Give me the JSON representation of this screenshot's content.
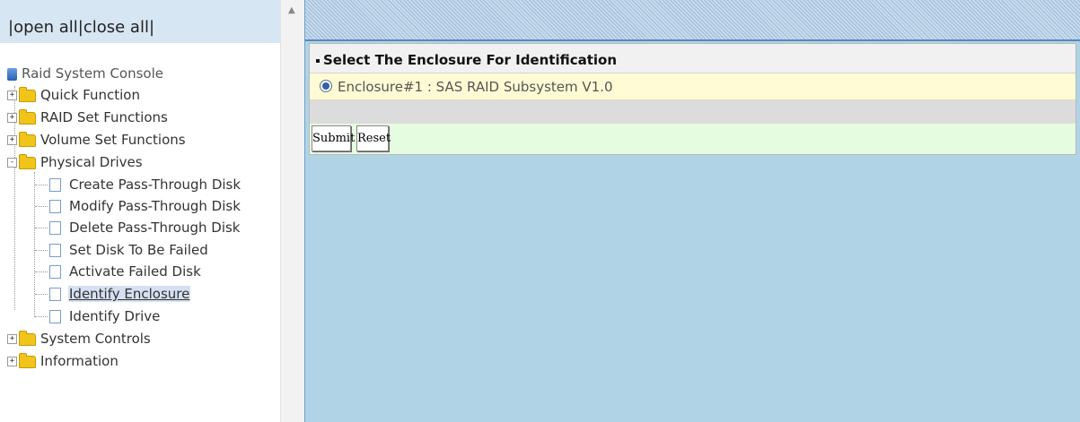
{
  "header": {
    "open_all": "open all",
    "close_all": "close all"
  },
  "tree": {
    "root": "Raid System Console",
    "items": [
      {
        "label": "Quick Function",
        "toggle": "+"
      },
      {
        "label": "RAID Set Functions",
        "toggle": "+"
      },
      {
        "label": "Volume Set Functions",
        "toggle": "+"
      },
      {
        "label": "Physical Drives",
        "toggle": "-",
        "children": [
          {
            "label": "Create Pass-Through Disk"
          },
          {
            "label": "Modify Pass-Through Disk"
          },
          {
            "label": "Delete Pass-Through Disk"
          },
          {
            "label": "Set Disk To Be Failed"
          },
          {
            "label": "Activate Failed Disk"
          },
          {
            "label": "Identify Enclosure",
            "selected": true
          },
          {
            "label": "Identify Drive"
          }
        ]
      },
      {
        "label": "System Controls",
        "toggle": "+"
      },
      {
        "label": "Information",
        "toggle": "+"
      }
    ]
  },
  "form": {
    "title": "Select The Enclosure For Identification",
    "option": "Enclosure#1 : SAS RAID Subsystem V1.0",
    "option_selected": true,
    "submit_label": "Submit",
    "reset_label": "Reset"
  },
  "colors": {
    "right_background": "#b0d4e6",
    "option_row": "#fffbd4",
    "button_row": "#e6fce0",
    "tree_selected": "#d5e1f2"
  }
}
